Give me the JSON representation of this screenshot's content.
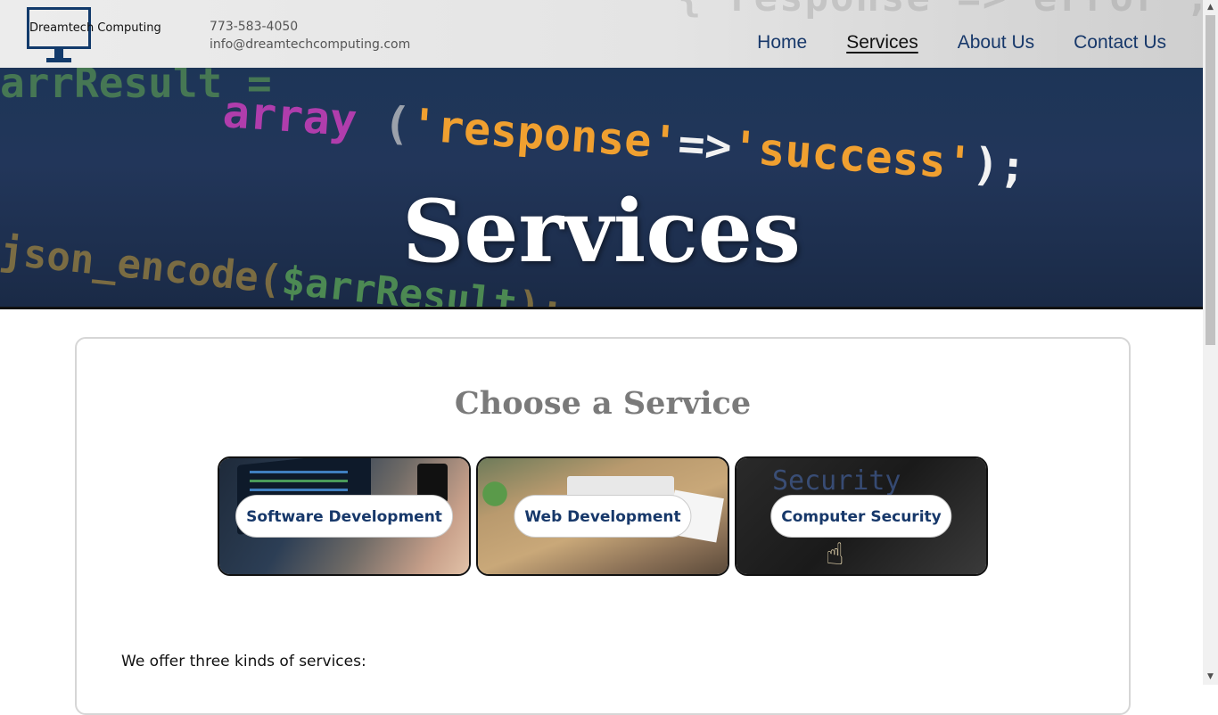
{
  "header": {
    "logo_text": "Dreamtech Computing",
    "phone": "773-583-4050",
    "email": "info@dreamtechcomputing.com",
    "nav": [
      {
        "label": "Home",
        "active": false
      },
      {
        "label": "Services",
        "active": true
      },
      {
        "label": "About Us",
        "active": false
      },
      {
        "label": "Contact Us",
        "active": false
      }
    ]
  },
  "hero": {
    "title": "Services"
  },
  "main": {
    "heading": "Choose a Service",
    "services": [
      {
        "label": "Software Development"
      },
      {
        "label": "Web Development"
      },
      {
        "label": "Computer Security"
      }
    ],
    "intro": "We offer three kinds of services:"
  },
  "colors": {
    "brand_navy": "#17386a",
    "heading_gray": "#7a7a7a"
  },
  "icons": {
    "logo": "monitor-icon",
    "scroll_up": "arrow-up-icon",
    "scroll_down": "arrow-down-icon"
  }
}
